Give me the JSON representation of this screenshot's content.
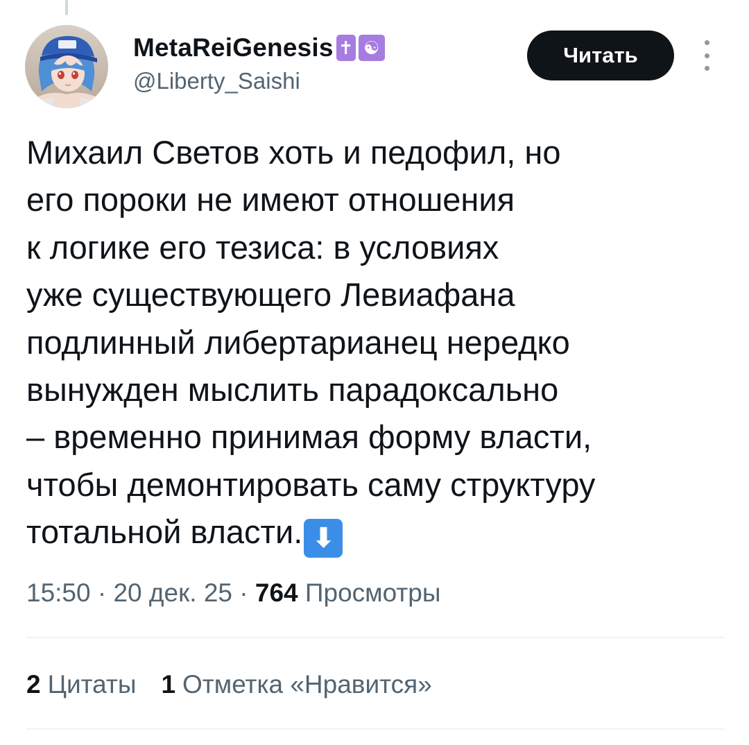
{
  "author": {
    "display_name": "MetaReiGenesis",
    "badges": [
      "✝",
      "☯"
    ],
    "handle": "@Liberty_Saishi"
  },
  "follow_label": "Читать",
  "tweet": {
    "lines": [
      "Михаил Светов хоть и педофил, но",
      "его пороки не имеют отношения",
      "к логике его тезиса: в условиях",
      "уже существующего Левиафана",
      "подлинный либертарианец нередко",
      "вынужден мыслить парадоксально",
      "– временно принимая форму власти,",
      "чтобы демонтировать саму структуру",
      "тотальной власти."
    ],
    "emoji": "⬇"
  },
  "meta": {
    "time": "15:50",
    "separator": " · ",
    "date": "20 дек. 25",
    "views_count": "764",
    "views_label": "Просмотры"
  },
  "stats": {
    "quotes_count": "2",
    "quotes_label": "Цитаты",
    "likes_count": "1",
    "likes_label": "Отметка «Нравится»"
  },
  "colors": {
    "text_primary": "#0f1419",
    "text_secondary": "#536471",
    "button_bg": "#0f1419",
    "badge_purple": "#a77ce0",
    "emoji_blue": "#3b8ee8",
    "divider": "#eff3f4"
  }
}
